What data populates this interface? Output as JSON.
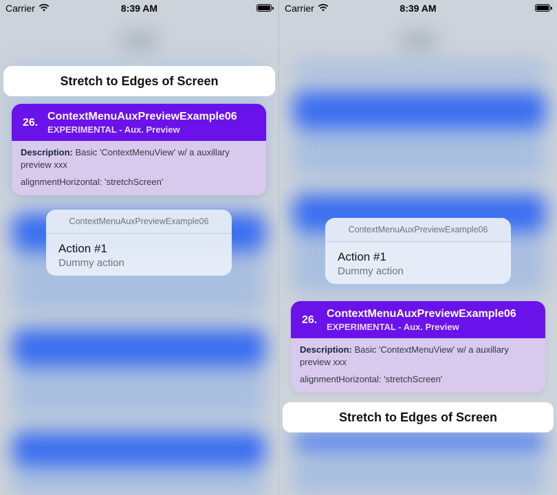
{
  "status_bar": {
    "carrier": "Carrier",
    "time": "8:39 AM"
  },
  "stretch_button": {
    "label": "Stretch to Edges of Screen"
  },
  "preview_card": {
    "number": "26.",
    "title": "ContextMenuAuxPreviewExample06",
    "subtitle": "EXPERIMENTAL - Aux. Preview",
    "description_label": "Description:",
    "description_text": " Basic 'ContextMenuView' w/ a auxillary preview xxx",
    "alignment_text": "alignmentHorizontal: 'stretchScreen'"
  },
  "context_menu": {
    "title": "ContextMenuAuxPreviewExample06",
    "items": [
      {
        "label": "Action #1",
        "subtitle": "Dummy action"
      }
    ]
  },
  "colors": {
    "card_header": "#6a12ea",
    "card_body": "#d8caec",
    "background_accent": "#3a6ef0"
  }
}
